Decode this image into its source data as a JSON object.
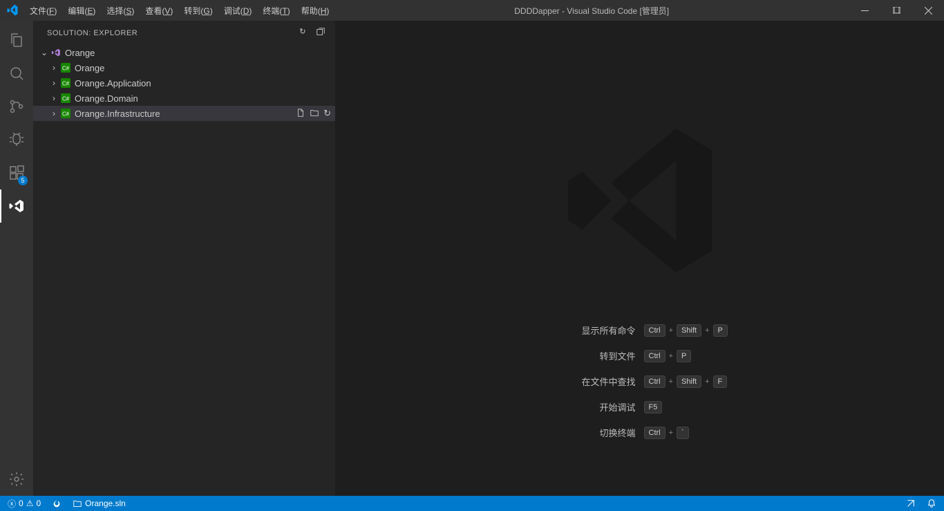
{
  "titlebar": {
    "title": "DDDDapper - Visual Studio Code [管理员]",
    "menu": [
      {
        "label": "文件",
        "accel": "F"
      },
      {
        "label": "编辑",
        "accel": "E"
      },
      {
        "label": "选择",
        "accel": "S"
      },
      {
        "label": "查看",
        "accel": "V"
      },
      {
        "label": "转到",
        "accel": "G"
      },
      {
        "label": "调试",
        "accel": "D"
      },
      {
        "label": "终端",
        "accel": "T"
      },
      {
        "label": "帮助",
        "accel": "H"
      }
    ]
  },
  "activitybar": {
    "extensions_badge": "5"
  },
  "sidebar": {
    "title": "SOLUTION: EXPLORER",
    "root": {
      "label": "Orange"
    },
    "projects": [
      {
        "label": "Orange"
      },
      {
        "label": "Orange.Application"
      },
      {
        "label": "Orange.Domain"
      },
      {
        "label": "Orange.Infrastructure",
        "hovered": true
      }
    ]
  },
  "welcome": {
    "shortcuts": [
      {
        "label": "显示所有命令",
        "keys": [
          "Ctrl",
          "+",
          "Shift",
          "+",
          "P"
        ]
      },
      {
        "label": "转到文件",
        "keys": [
          "Ctrl",
          "+",
          "P"
        ]
      },
      {
        "label": "在文件中查找",
        "keys": [
          "Ctrl",
          "+",
          "Shift",
          "+",
          "F"
        ]
      },
      {
        "label": "开始调试",
        "keys": [
          "F5"
        ]
      },
      {
        "label": "切换终端",
        "keys": [
          "Ctrl",
          "+",
          "`"
        ]
      }
    ]
  },
  "statusbar": {
    "errors": "0",
    "warnings": "0",
    "solution": "Orange.sln"
  }
}
